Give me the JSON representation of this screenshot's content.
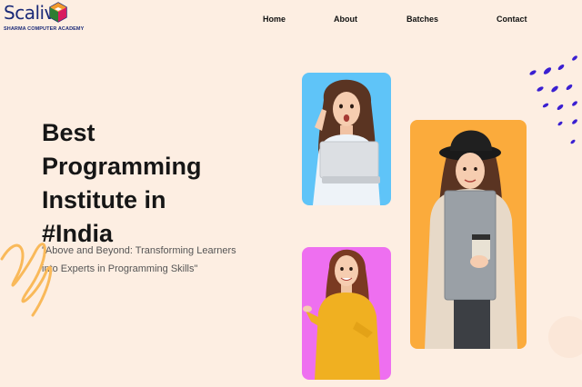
{
  "brand": {
    "name": "Scalive",
    "tagline": "SHARMA COMPUTER ACADEMY"
  },
  "nav": {
    "items": [
      "Home",
      "About",
      "Batches",
      "Contact"
    ]
  },
  "hero": {
    "title_line1": "Best Programming",
    "title_line2": "Institute in",
    "title_line3": "#India",
    "subtitle": "\"Above and Beyond: Transforming Learners into Experts in Programming Skills\""
  },
  "colors": {
    "background": "#fdeee2",
    "brand": "#1b2a78",
    "card_blue": "#5fc4f8",
    "card_pink": "#ee6ff0",
    "card_orange": "#fbab3c",
    "dots": "#3a1fd1",
    "squiggle": "#f9b95a"
  }
}
